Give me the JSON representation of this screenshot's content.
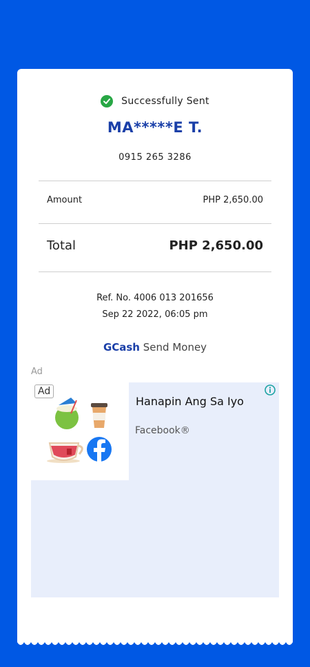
{
  "transaction": {
    "status": "Successfully Sent",
    "recipient_name": "MA*****E T.",
    "recipient_number": "0915 265 3286",
    "amount_label": "Amount",
    "amount_value": "PHP 2,650.00",
    "total_label": "Total",
    "total_value": "PHP 2,650.00",
    "reference": "Ref. No. 4006 013 201656",
    "datetime": "Sep 22 2022, 06:05 pm"
  },
  "brand": {
    "name": "GCash",
    "service": "Send Money"
  },
  "ad": {
    "label": "Ad",
    "badge": "Ad",
    "title": "Hanapin Ang Sa Iyo",
    "source": "Facebook®",
    "icons": [
      "coconut-drink-icon",
      "coffee-cup-icon",
      "tea-cup-icon",
      "facebook-logo-icon",
      "info-icon"
    ]
  },
  "colors": {
    "background": "#0058e4",
    "brand": "#1a3fa8",
    "success": "#28a745",
    "ad_bg": "#e8eefb"
  }
}
